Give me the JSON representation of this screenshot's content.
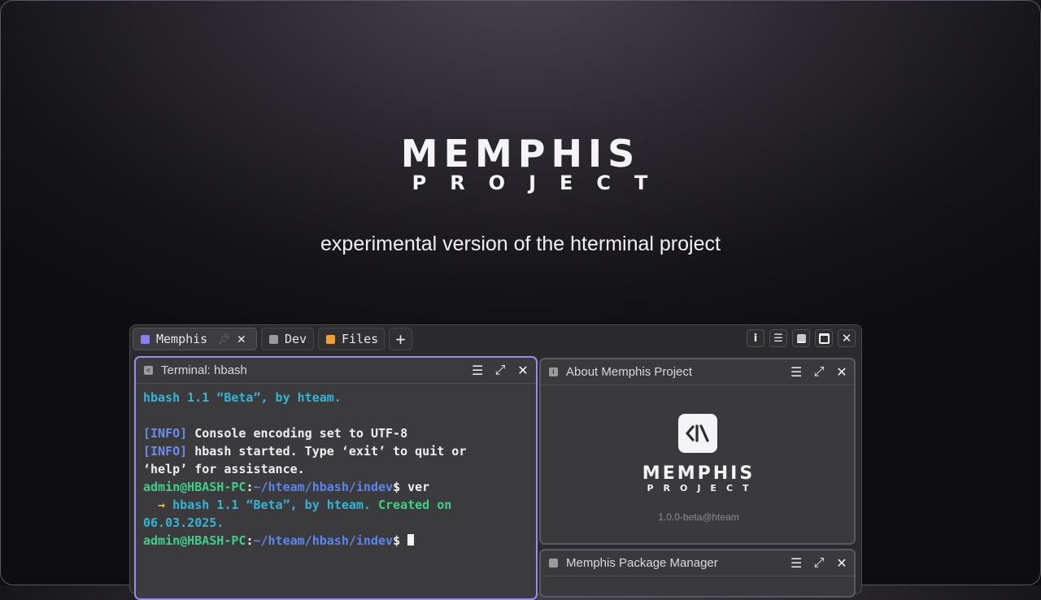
{
  "hero": {
    "title": "MEMPHIS",
    "subtitle": "PROJECT",
    "tagline": "experimental version of the hterminal project"
  },
  "tabs": [
    {
      "label": "Memphis",
      "color": "#8d7df2",
      "pinned": true,
      "closable": true,
      "active": true
    },
    {
      "label": "Dev",
      "color": "#9a9aa0"
    },
    {
      "label": "Files",
      "color": "#f0a030"
    }
  ],
  "add_tab_label": "+",
  "window_controls": {
    "info": "i",
    "menu": "☰",
    "close": "✕"
  },
  "terminal": {
    "title": "Terminal: hbash",
    "lines": {
      "banner": "hbash 1.1 “Beta”, by hteam.",
      "info_tag": "[INFO]",
      "info1": " Console encoding set to UTF-8",
      "info2": " hbash started. Type ‘exit’ to quit or",
      "info2b": "‘help’ for assistance.",
      "user": "admin@HBASH-PC",
      "colon": ":",
      "path": "~/hteam/hbash/indev",
      "prompt": "$ ",
      "cmd": "ver",
      "arrow": "  → ",
      "out1": "hbash 1.1 “Beta”, by hteam. ",
      "out1b": "Created on",
      "out2": "06.03.2025."
    }
  },
  "about": {
    "title": "About Memphis Project",
    "logo_title": "MEMPHIS",
    "logo_sub": "PROJECT",
    "version": "1.0.0-beta@hteam"
  },
  "package_manager": {
    "title": "Memphis Package Manager"
  },
  "colors": {
    "active_border": "#9b8cf0",
    "accent_cyan": "#32b6d4",
    "accent_green": "#3fd08a"
  }
}
